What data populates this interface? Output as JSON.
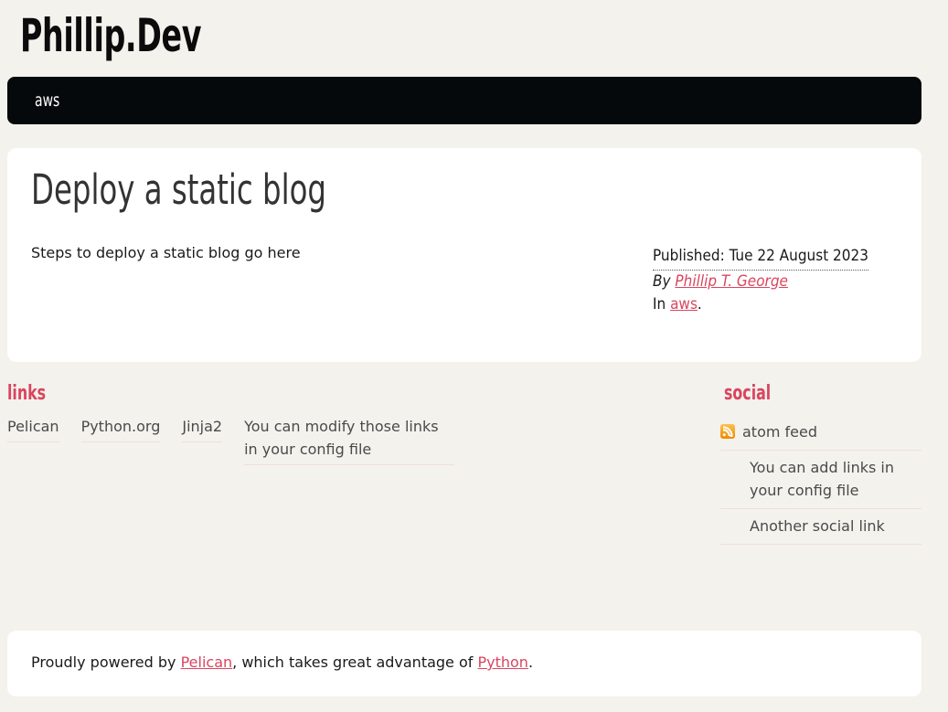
{
  "site": {
    "title": "Phillip.Dev"
  },
  "nav": {
    "items": [
      {
        "label": "aws",
        "name": "nav-link-aws"
      }
    ]
  },
  "article": {
    "title": "Deploy a static blog",
    "body": "Steps to deploy a static blog go here",
    "meta": {
      "published": "Published: Tue 22 August 2023",
      "by_label": "By",
      "author": "Phillip T. George",
      "in_label": "In",
      "category": "aws",
      "period": "."
    }
  },
  "links_widget": {
    "title": "links",
    "items": [
      {
        "label": "Pelican"
      },
      {
        "label": "Python.org"
      },
      {
        "label": "Jinja2"
      },
      {
        "label": "You can modify those links in your config file"
      }
    ]
  },
  "social_widget": {
    "title": "social",
    "items": [
      {
        "label": "atom feed",
        "icon": "rss-icon",
        "has_icon": true,
        "indent": false
      },
      {
        "label": "You can add links in your config file",
        "has_icon": false,
        "indent": true
      },
      {
        "label": "Another social link",
        "has_icon": false,
        "indent": true
      }
    ]
  },
  "footer": {
    "prefix": "Proudly powered by ",
    "link1": "Pelican",
    "middle": ", which takes great advantage of ",
    "link2": "Python",
    "suffix": "."
  },
  "colors": {
    "page_background": "#f3f2ed",
    "card_background": "#ffffff",
    "nav_background": "#06090b",
    "accent_red": "#d9465f",
    "heading_red": "#d9455f",
    "rss_orange": "#f5a623",
    "text_dark": "#1a1a1a",
    "text_muted": "#4a4a4a"
  }
}
